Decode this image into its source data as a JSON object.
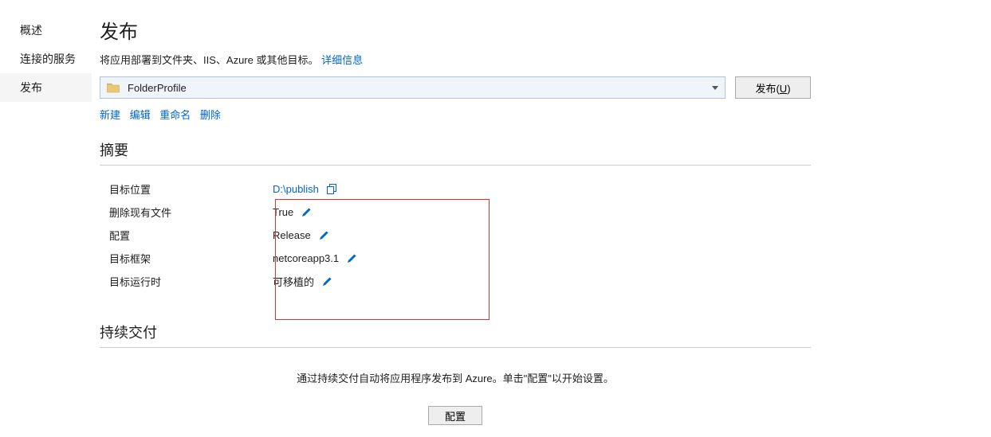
{
  "sidebar": {
    "items": [
      {
        "label": "概述"
      },
      {
        "label": "连接的服务"
      },
      {
        "label": "发布"
      }
    ]
  },
  "header": {
    "title": "发布",
    "subtitle": "将应用部署到文件夹、IIS、Azure 或其他目标。",
    "detail_link": "详细信息"
  },
  "profile": {
    "name": "FolderProfile",
    "publish_btn_prefix": "发布(",
    "publish_btn_key": "U",
    "publish_btn_suffix": ")",
    "actions": {
      "new": "新建",
      "edit": "编辑",
      "rename": "重命名",
      "delete": "删除"
    }
  },
  "summary": {
    "title": "摘要",
    "rows": {
      "target_location": {
        "label": "目标位置",
        "value": "D:\\publish"
      },
      "delete_existing": {
        "label": "删除现有文件",
        "value": "True"
      },
      "configuration": {
        "label": "配置",
        "value": "Release"
      },
      "target_framework": {
        "label": "目标框架",
        "value": "netcoreapp3.1"
      },
      "target_runtime": {
        "label": "目标运行时",
        "value": "可移植的"
      }
    }
  },
  "cd": {
    "title": "持续交付",
    "desc": "通过持续交付自动将应用程序发布到 Azure。单击\"配置\"以开始设置。",
    "configure_btn": "配置"
  }
}
